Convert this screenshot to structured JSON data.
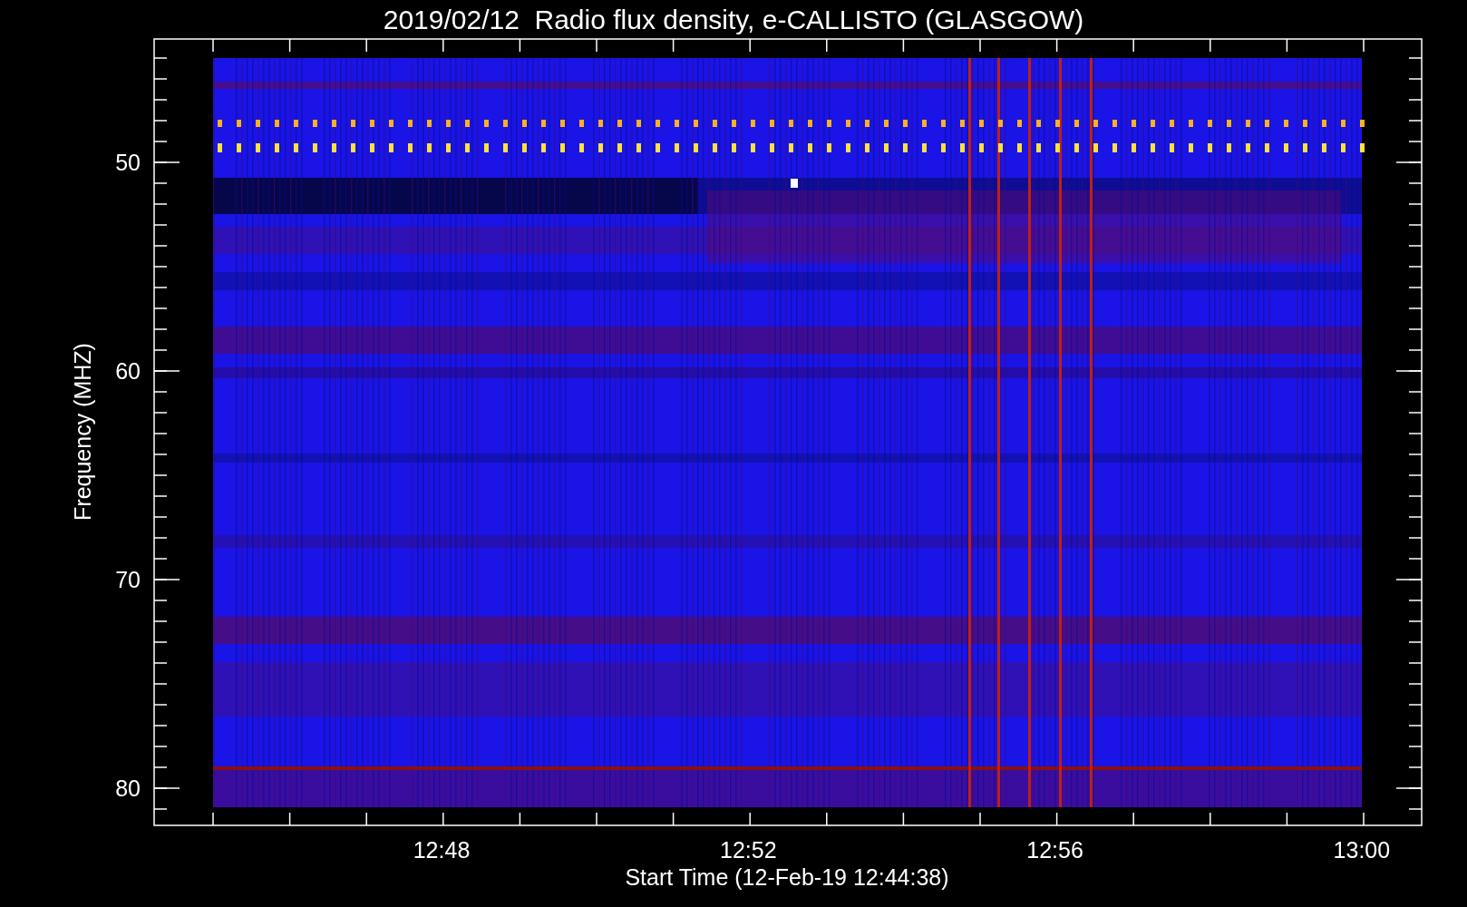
{
  "title": "2019/02/12  Radio flux density, e-CALLISTO (GLASGOW)",
  "spectrogram": {
    "ylabel": "Frequency (MHZ)",
    "xlabel": "Start Time (12-Feb-19 12:44:38)",
    "yticks": [
      "50",
      "60",
      "70",
      "80"
    ],
    "xticks": [
      "12:48",
      "12:52",
      "12:56",
      "13:00"
    ]
  }
}
